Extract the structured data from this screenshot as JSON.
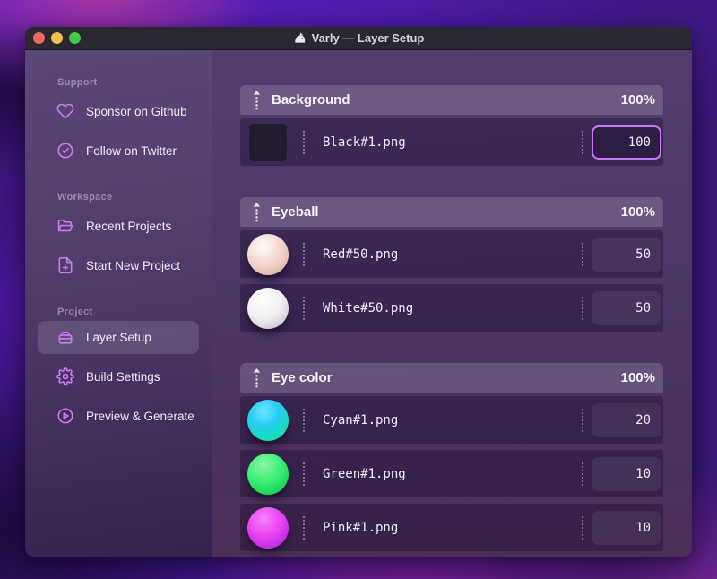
{
  "window": {
    "title": "Varly — Layer Setup"
  },
  "titlebar": {
    "traffic_lights": [
      {
        "name": "close-button",
        "color": "#ed6a5e"
      },
      {
        "name": "minimize-button",
        "color": "#f4bf4b"
      },
      {
        "name": "zoom-button",
        "color": "#43c748"
      }
    ]
  },
  "sidebar": {
    "sections": [
      {
        "label": "Support",
        "items": [
          {
            "label": "Sponsor on Github",
            "icon": "heart-icon"
          },
          {
            "label": "Follow on Twitter",
            "icon": "verified-check-icon"
          }
        ]
      },
      {
        "label": "Workspace",
        "items": [
          {
            "label": "Recent Projects",
            "icon": "folder-open-icon"
          },
          {
            "label": "Start New Project",
            "icon": "file-plus-icon"
          }
        ]
      },
      {
        "label": "Project",
        "items": [
          {
            "label": "Layer Setup",
            "icon": "layers-icon",
            "active": true
          },
          {
            "label": "Build Settings",
            "icon": "gear-icon"
          },
          {
            "label": "Preview & Generate",
            "icon": "play-circle-icon"
          }
        ]
      }
    ]
  },
  "layers": {
    "groups": [
      {
        "name": "Background",
        "weight": "100%",
        "items": [
          {
            "file": "Black#1.png",
            "value": "100",
            "thumb": "black-square",
            "focused": true
          }
        ]
      },
      {
        "name": "Eyeball",
        "weight": "100%",
        "items": [
          {
            "file": "Red#50.png",
            "value": "50",
            "thumb": "red-sphere"
          },
          {
            "file": "White#50.png",
            "value": "50",
            "thumb": "white-sphere"
          }
        ]
      },
      {
        "name": "Eye color",
        "weight": "100%",
        "items": [
          {
            "file": "Cyan#1.png",
            "value": "20",
            "thumb": "cyan-sphere"
          },
          {
            "file": "Green#1.png",
            "value": "10",
            "thumb": "green-sphere"
          },
          {
            "file": "Pink#1.png",
            "value": "10",
            "thumb": "pink-sphere"
          }
        ]
      }
    ]
  },
  "colors": {
    "accent": "#c97df2",
    "focus_border": "#c678fa",
    "header_bg_tint": "#6a547f",
    "row_bg": "#3f2b58",
    "titlebar_bg": "#2b2731"
  }
}
